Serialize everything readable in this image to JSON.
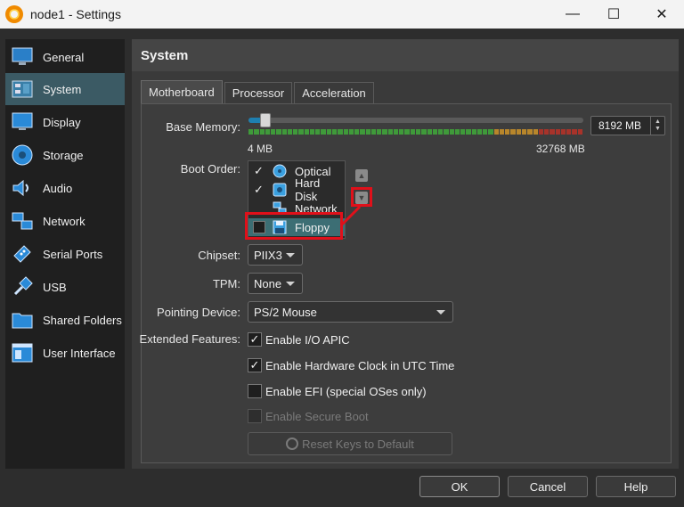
{
  "window": {
    "title": "node1 - Settings",
    "min_glyph": "—",
    "max_glyph": "☐",
    "close_glyph": "✕"
  },
  "sidebar": {
    "items": [
      {
        "label": "General",
        "icon": "general-icon"
      },
      {
        "label": "System",
        "icon": "system-icon",
        "active": true
      },
      {
        "label": "Display",
        "icon": "display-icon"
      },
      {
        "label": "Storage",
        "icon": "storage-icon"
      },
      {
        "label": "Audio",
        "icon": "audio-icon"
      },
      {
        "label": "Network",
        "icon": "network-icon"
      },
      {
        "label": "Serial Ports",
        "icon": "serial-ports-icon"
      },
      {
        "label": "USB",
        "icon": "usb-icon"
      },
      {
        "label": "Shared Folders",
        "icon": "shared-folders-icon"
      },
      {
        "label": "User Interface",
        "icon": "user-interface-icon"
      }
    ]
  },
  "main": {
    "title": "System",
    "tabs": [
      {
        "label": "Motherboard",
        "active": true
      },
      {
        "label": "Processor"
      },
      {
        "label": "Acceleration"
      }
    ]
  },
  "motherboard": {
    "base_memory_label": "Base Memory:",
    "memory_value": "8192 MB",
    "memory_min_label": "4 MB",
    "memory_max_label": "32768 MB",
    "memory_fraction": 0.25,
    "boot_order_label": "Boot Order:",
    "boot_items": [
      {
        "name": "Optical",
        "checked": true,
        "icon": "optical-disc-icon"
      },
      {
        "name": "Hard Disk",
        "checked": true,
        "icon": "hard-disk-icon"
      },
      {
        "name": "Network",
        "checked": false,
        "icon": "network-icon"
      },
      {
        "name": "Floppy",
        "checked": false,
        "icon": "floppy-icon"
      }
    ],
    "chipset_label": "Chipset:",
    "chipset_value": "PIIX3",
    "tpm_label": "TPM:",
    "tpm_value": "None",
    "pointing_label": "Pointing Device:",
    "pointing_value": "PS/2 Mouse",
    "extended_label": "Extended Features:",
    "features": [
      {
        "label": "Enable I/O APIC",
        "checked": true,
        "disabled": false
      },
      {
        "label": "Enable Hardware Clock in UTC Time",
        "checked": true,
        "disabled": false
      },
      {
        "label": "Enable EFI (special OSes only)",
        "checked": false,
        "disabled": false
      },
      {
        "label": "Enable Secure Boot",
        "checked": false,
        "disabled": true
      }
    ],
    "reset_keys_label": "Reset Keys to Default"
  },
  "buttons": {
    "ok": "OK",
    "cancel": "Cancel",
    "help": "Help"
  },
  "colors": {
    "accent_selected": "#3c6e74",
    "highlight_red": "#e0101a",
    "slider_blue": "#1e7fb0"
  }
}
